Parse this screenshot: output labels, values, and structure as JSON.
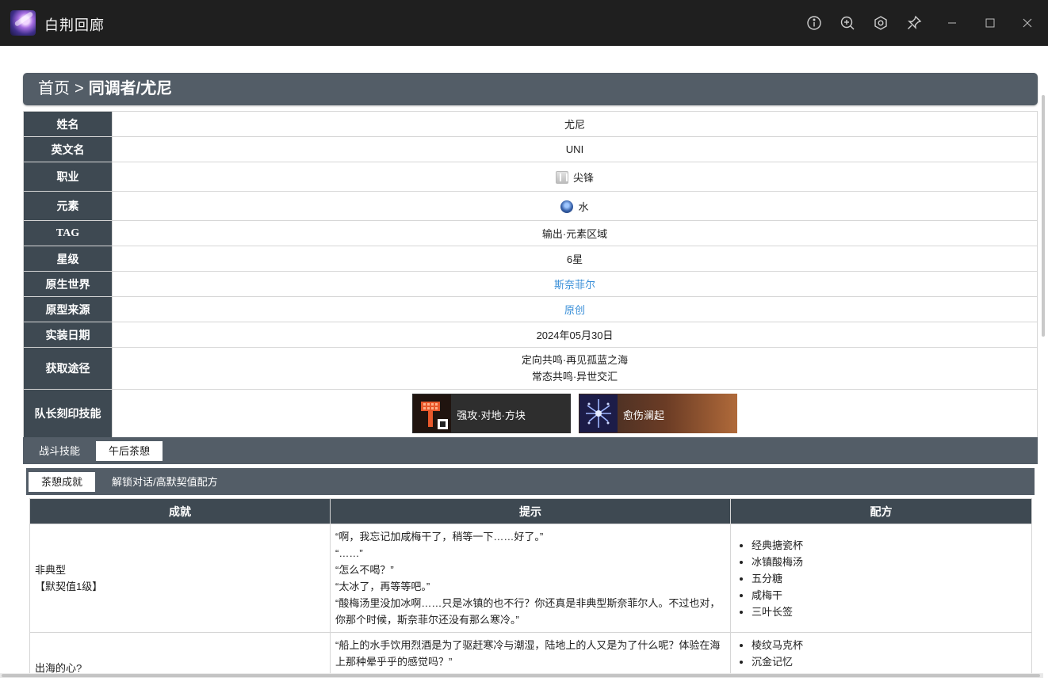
{
  "window": {
    "title": "白荆回廊"
  },
  "breadcrumb": {
    "home": "首页",
    "separator": ">",
    "current": "同调者/尤尼"
  },
  "info": {
    "rows": [
      {
        "label": "姓名",
        "value": "尤尼"
      },
      {
        "label": "英文名",
        "value": "UNI"
      },
      {
        "label": "职业",
        "value": "尖锋"
      },
      {
        "label": "元素",
        "value": "水"
      },
      {
        "label": "TAG",
        "value": "输出·元素区域"
      },
      {
        "label": "星级",
        "value": "6星"
      },
      {
        "label": "原生世界",
        "value": "斯奈菲尔"
      },
      {
        "label": "原型来源",
        "value": "原创"
      },
      {
        "label": "实装日期",
        "value": "2024年05月30日"
      },
      {
        "label": "获取途径",
        "value": [
          "定向共鸣·再见孤蓝之海",
          "常态共鸣·异世交汇"
        ]
      },
      {
        "label": "队长刻印技能",
        "value": [
          "强攻·对地·方块",
          "愈伤澜起"
        ]
      }
    ]
  },
  "tabs_primary": [
    "战斗技能",
    "午后茶憩"
  ],
  "tabs_secondary": [
    "茶憩成就",
    "解锁对话/高默契值配方"
  ],
  "achievements": {
    "headers": [
      "成就",
      "提示",
      "配方"
    ],
    "rows": [
      {
        "name": [
          "非典型",
          "【默契值1级】"
        ],
        "hints": [
          "“啊，我忘记加咸梅干了，稍等一下……好了。”",
          "“……”",
          "“怎么不喝？”",
          "“太冰了，再等等吧。”",
          "“酸梅汤里没加冰啊……只是冰镇的也不行？你还真是非典型斯奈菲尔人。不过也对，你那个时候，斯奈菲尔还没有那么寒冷。”"
        ],
        "recipe": [
          "经典搪瓷杯",
          "冰镇酸梅汤",
          "五分糖",
          "咸梅干",
          "三叶长签"
        ]
      },
      {
        "name": [
          "出海的心?"
        ],
        "hints": [
          "“船上的水手饮用烈酒是为了驱赶寒冷与潮湿，陆地上的人又是为了什么呢？体验在海上那种晕乎乎的感觉吗？”"
        ],
        "recipe": [
          "棱纹马克杯",
          "沉金记忆"
        ]
      }
    ]
  },
  "icons": {
    "window_controls": [
      "info-icon",
      "zoom-in-icon",
      "settings-icon",
      "pin-icon",
      "minimize-icon",
      "maximize-icon",
      "close-icon"
    ]
  }
}
